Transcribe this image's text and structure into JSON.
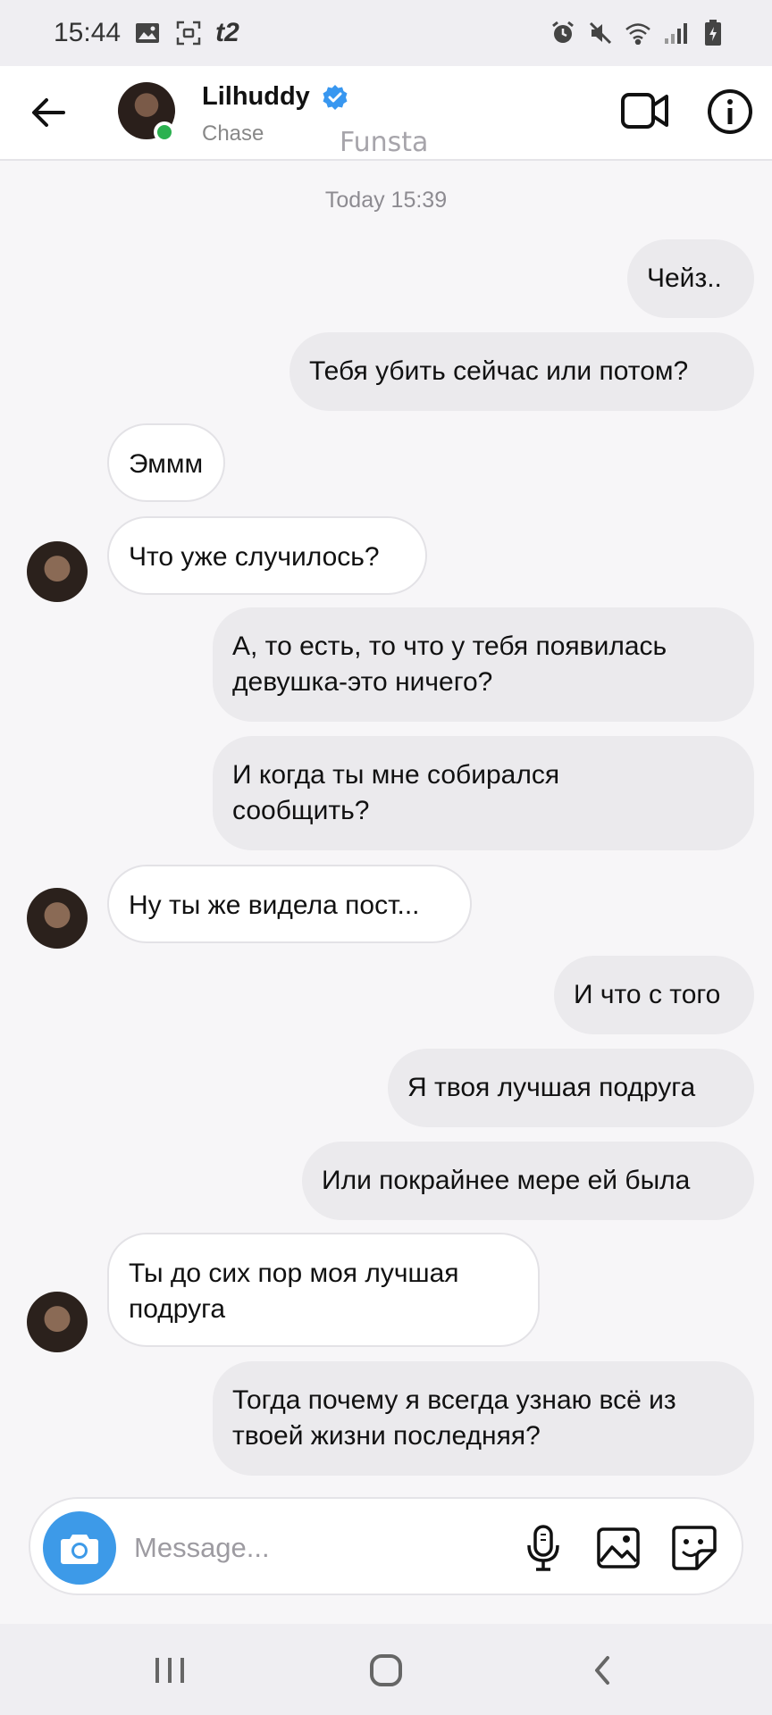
{
  "status_bar": {
    "time": "15:44",
    "carrier": "t2"
  },
  "header": {
    "name": "Lilhuddy",
    "subtitle": "Chase"
  },
  "watermark": "Funsta",
  "timestamp": "Today 15:39",
  "messages": [
    {
      "dir": "out",
      "text": "Чейз.."
    },
    {
      "dir": "out",
      "text": "Тебя убить сейчас или потом?"
    },
    {
      "dir": "in",
      "text": "Эммм"
    },
    {
      "dir": "in",
      "text": "Что уже случилось?"
    },
    {
      "dir": "out",
      "text": "А, то есть, то что у тебя появилась\nдевушка-это ничего?"
    },
    {
      "dir": "out",
      "text": "И когда ты мне собирался\nсообщить?"
    },
    {
      "dir": "in",
      "text": "Ну ты же видела пост..."
    },
    {
      "dir": "out",
      "text": "И что с того"
    },
    {
      "dir": "out",
      "text": "Я твоя лучшая подруга"
    },
    {
      "dir": "out",
      "text": "Или покрайнее мере ей была"
    },
    {
      "dir": "in",
      "text": "Ты до сих пор моя лучшая\nподруга"
    },
    {
      "dir": "out",
      "text": "Тогда почему я всегда узнаю всё из\nтвоей жизни последняя?"
    }
  ],
  "composer": {
    "placeholder": "Message..."
  },
  "colors": {
    "accent_blue": "#3d9ae8",
    "verified_blue": "#3897f0",
    "online_green": "#2bb14f",
    "outgoing_bubble": "#ebeaed",
    "incoming_bubble": "#ffffff"
  }
}
